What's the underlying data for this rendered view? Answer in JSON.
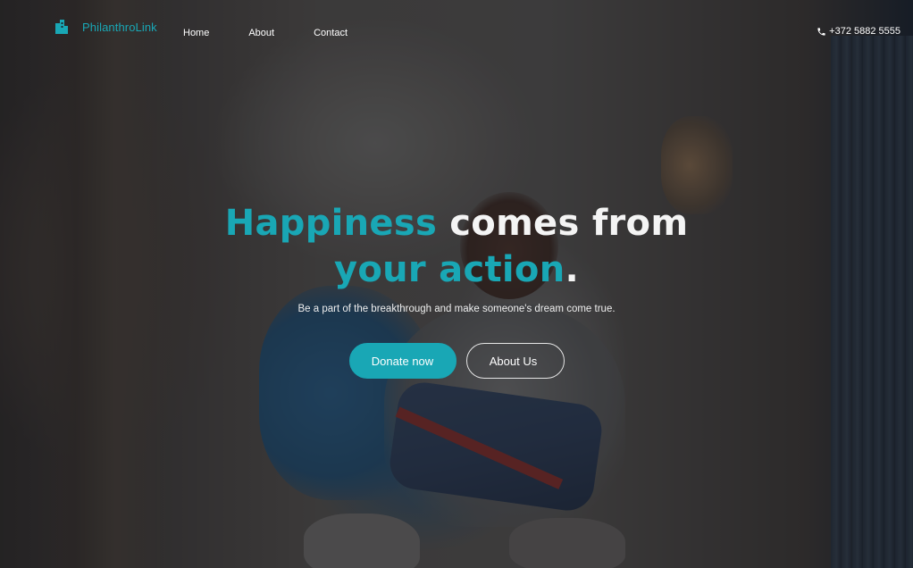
{
  "brand": {
    "name": "PhilanthroLink",
    "icon": "building-icon"
  },
  "nav": {
    "links": [
      {
        "label": "Home"
      },
      {
        "label": "About"
      },
      {
        "label": "Contact"
      }
    ]
  },
  "contact": {
    "phone": "+372 5882 5555",
    "icon": "phone-icon"
  },
  "hero": {
    "headline_part1": "Happiness",
    "headline_part2": " comes from",
    "headline_part3": "your action",
    "headline_part4": ".",
    "subtitle": "Be a part of the breakthrough and make someone's dream come true.",
    "primary_cta": "Donate now",
    "secondary_cta": "About Us"
  },
  "colors": {
    "accent": "#19a7b5",
    "text": "#ffffff",
    "overlay": "#12161c"
  }
}
